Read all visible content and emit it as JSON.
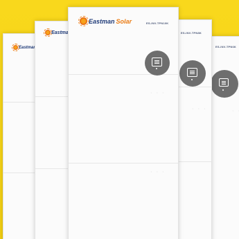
{
  "scene": {
    "background_color": "#f7d51a",
    "units": [
      {
        "id": "far-left",
        "brand_main": "Eastman",
        "brand_sub": "",
        "model": ""
      },
      {
        "id": "left",
        "brand_main": "Eastman",
        "brand_sub": "",
        "model": ""
      },
      {
        "id": "center",
        "brand_main": "Eastman",
        "brand_sub": "Solar",
        "model": "ES-INV-TPN10K"
      },
      {
        "id": "right",
        "brand_main": "",
        "brand_sub": "",
        "model": "ES-INV-TPN8K"
      },
      {
        "id": "far-right",
        "brand_main": "",
        "brand_sub": "",
        "model": "ES-INV-TPN6K"
      }
    ],
    "display_icon": "lcd-display-icon",
    "logo_icon": "sun-logo-icon"
  }
}
